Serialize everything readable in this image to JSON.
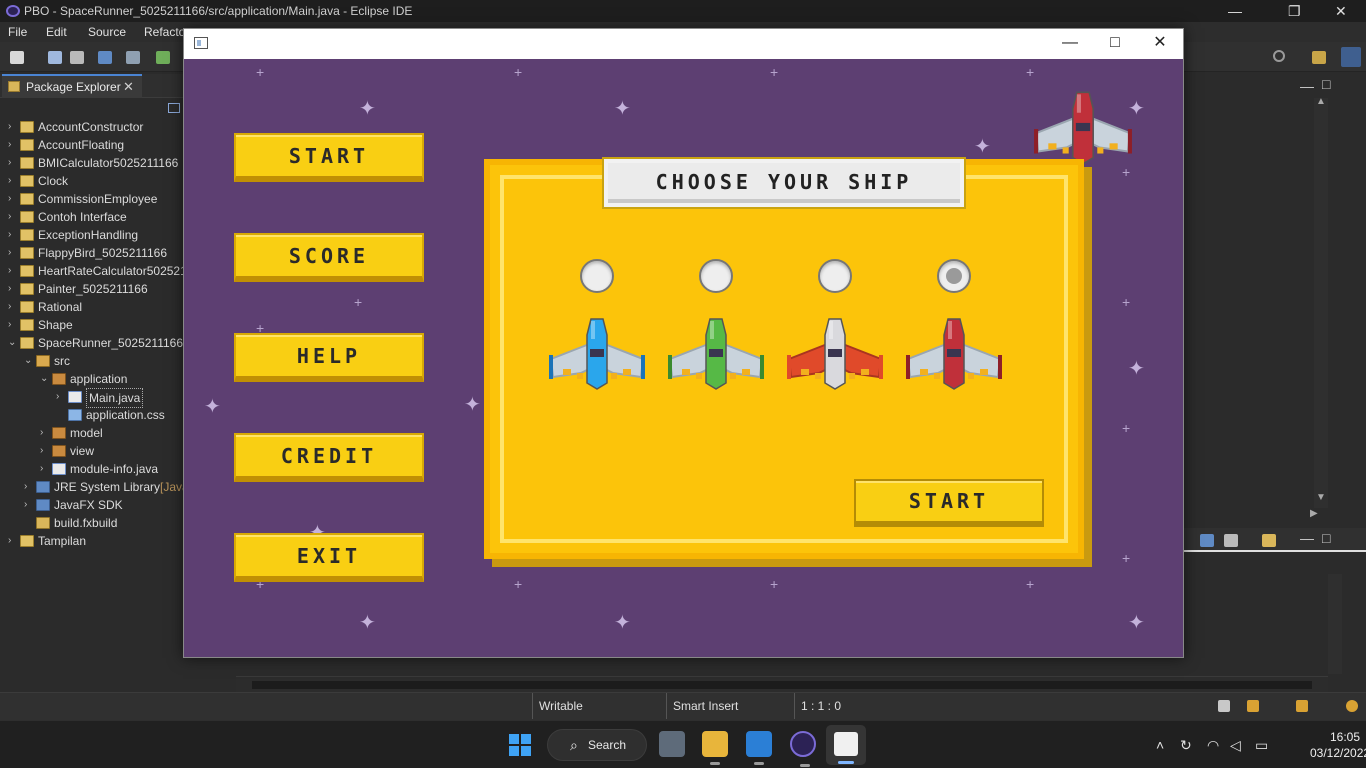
{
  "eclipse": {
    "title": "PBO - SpaceRunner_5025211166/src/application/Main.java - Eclipse IDE",
    "menu": [
      "File",
      "Edit",
      "Source",
      "Refactor"
    ],
    "view_tab": "Package Explorer",
    "tree": [
      {
        "label": "AccountConstructor",
        "indent": 0,
        "expanded": false,
        "icon": "project-icon"
      },
      {
        "label": "AccountFloating",
        "indent": 0,
        "expanded": false,
        "icon": "project-icon"
      },
      {
        "label": "BMICalculator5025211166",
        "indent": 0,
        "expanded": false,
        "icon": "project-icon"
      },
      {
        "label": "Clock",
        "indent": 0,
        "expanded": false,
        "icon": "project-icon"
      },
      {
        "label": "CommissionEmployee",
        "indent": 0,
        "expanded": false,
        "icon": "project-icon"
      },
      {
        "label": "Contoh Interface",
        "indent": 0,
        "expanded": false,
        "icon": "project-icon"
      },
      {
        "label": "ExceptionHandling",
        "indent": 0,
        "expanded": false,
        "icon": "project-icon"
      },
      {
        "label": "FlappyBird_5025211166",
        "indent": 0,
        "expanded": false,
        "icon": "project-icon"
      },
      {
        "label": "HeartRateCalculator502521",
        "indent": 0,
        "expanded": false,
        "icon": "project-icon"
      },
      {
        "label": "Painter_5025211166",
        "indent": 0,
        "expanded": false,
        "icon": "project-icon"
      },
      {
        "label": "Rational",
        "indent": 0,
        "expanded": false,
        "icon": "project-icon"
      },
      {
        "label": "Shape",
        "indent": 0,
        "expanded": false,
        "icon": "project-icon"
      },
      {
        "label": "SpaceRunner_5025211166",
        "indent": 0,
        "expanded": true,
        "icon": "project-icon"
      },
      {
        "label": "src",
        "indent": 1,
        "expanded": true,
        "icon": "folder-icon"
      },
      {
        "label": "application",
        "indent": 2,
        "expanded": true,
        "icon": "package-icon"
      },
      {
        "label": "Main.java",
        "indent": 3,
        "expanded": false,
        "icon": "java-file-icon"
      },
      {
        "label": "application.css",
        "indent": 3,
        "expanded": null,
        "icon": "css-file-icon"
      },
      {
        "label": "model",
        "indent": 2,
        "expanded": false,
        "icon": "package-icon"
      },
      {
        "label": "view",
        "indent": 2,
        "expanded": false,
        "icon": "package-icon"
      },
      {
        "label": "module-info.java",
        "indent": 2,
        "expanded": false,
        "icon": "java-file-icon"
      },
      {
        "label": "JRE System Library",
        "suffix": "[Java",
        "indent": 1,
        "expanded": false,
        "icon": "library-icon"
      },
      {
        "label": "JavaFX SDK",
        "indent": 1,
        "expanded": false,
        "icon": "library-icon"
      },
      {
        "label": "build.fxbuild",
        "indent": 1,
        "expanded": null,
        "icon": "fxbuild-file-icon"
      },
      {
        "label": "Tampilan",
        "indent": 0,
        "expanded": false,
        "icon": "project-icon"
      }
    ],
    "status": {
      "mode": "Writable",
      "insert": "Smart Insert",
      "position": "1 : 1 : 0"
    }
  },
  "game": {
    "menu_buttons": [
      "START",
      "SCORE",
      "HELP",
      "CREDIT",
      "EXIT"
    ],
    "panel_title": "CHOOSE YOUR SHIP",
    "ships": [
      {
        "name": "blue-ship",
        "body": "#2aa6ec",
        "accent": "#1a73b8",
        "selected": false
      },
      {
        "name": "green-ship",
        "body": "#56b946",
        "accent": "#3a8a2f",
        "selected": false
      },
      {
        "name": "orange-ship",
        "body": "#d9d9dd",
        "accent": "#e04a2a",
        "selected": false
      },
      {
        "name": "red-ship",
        "body": "#c0303a",
        "accent": "#8e1f28",
        "selected": true
      }
    ],
    "start_label": "START",
    "colors": {
      "background": "#5d3f72",
      "panel": "#fcc40a",
      "button": "#f9cf13"
    }
  },
  "taskbar": {
    "search_label": "Search",
    "time": "16:05",
    "date": "03/12/2022"
  }
}
